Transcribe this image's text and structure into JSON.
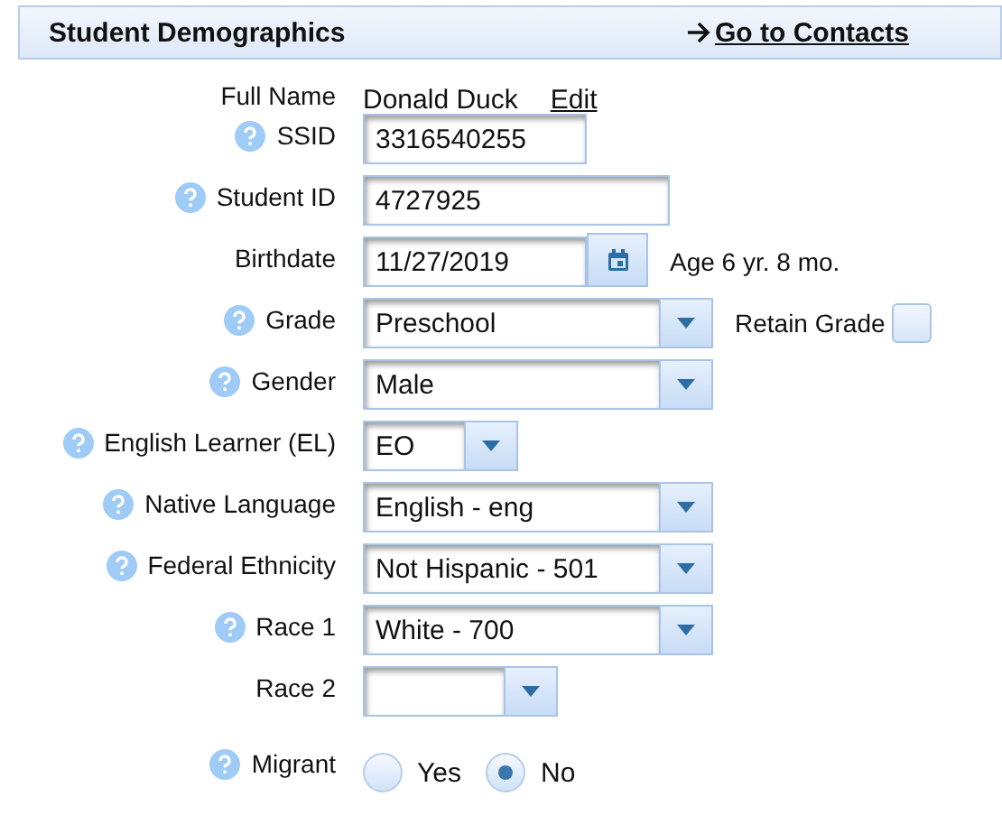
{
  "header": {
    "title": "Student Demographics",
    "link": "Go to Contacts"
  },
  "fields": [
    {
      "label": "Full Name",
      "help": false,
      "kind": "name",
      "value": "Donald Duck",
      "link": "Edit"
    },
    {
      "label": "SSID",
      "help": true,
      "kind": "text",
      "value": "3316540255"
    },
    {
      "label": "Student ID",
      "help": true,
      "kind": "text",
      "value": "4727925"
    },
    {
      "label": "Birthdate",
      "help": false,
      "kind": "date",
      "value": "11/27/2019",
      "note": "Age 6 yr. 8 mo."
    },
    {
      "label": "Grade",
      "help": true,
      "kind": "select",
      "value": "Preschool",
      "checkbox": {
        "label": "Retain Grade",
        "checked": false
      }
    },
    {
      "label": "Gender",
      "help": true,
      "kind": "select",
      "value": "Male"
    },
    {
      "label": "English Learner (EL)",
      "help": true,
      "kind": "select",
      "value": "EO"
    },
    {
      "label": "Native Language",
      "help": true,
      "kind": "select",
      "value": "English - eng"
    },
    {
      "label": "Federal Ethnicity",
      "help": true,
      "kind": "select",
      "value": "Not Hispanic - 501"
    },
    {
      "label": "Race 1",
      "help": true,
      "kind": "select",
      "value": "White - 700"
    },
    {
      "label": "Race 2",
      "help": false,
      "kind": "select"
    },
    {
      "label": "Migrant",
      "help": true,
      "kind": "radio",
      "options": [
        {
          "label": "Yes",
          "selected": false
        },
        {
          "label": "No",
          "selected": true
        }
      ]
    }
  ]
}
